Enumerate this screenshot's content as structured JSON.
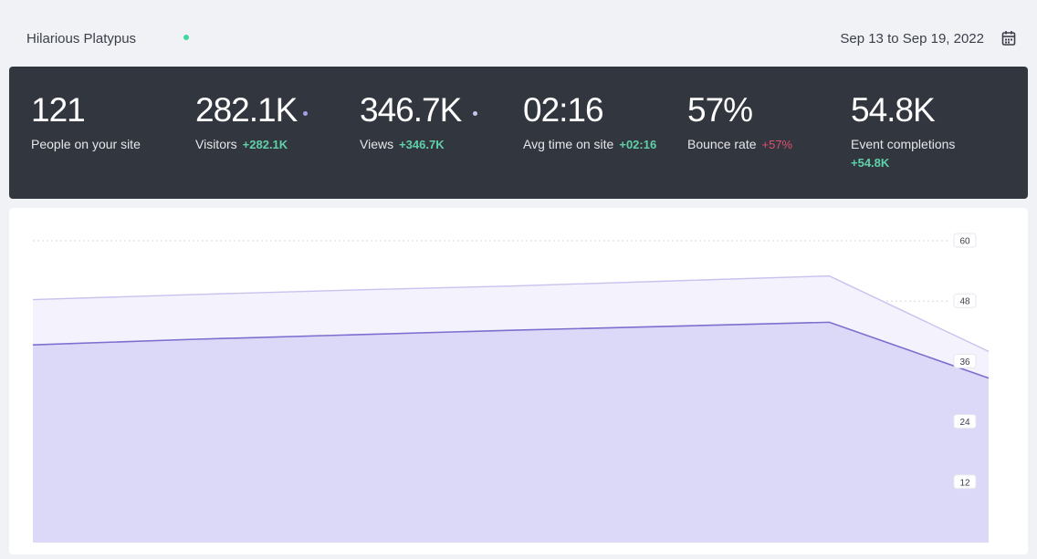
{
  "header": {
    "site_name": "Hilarious Platypus",
    "date_range": "Sep 13 to Sep 19, 2022"
  },
  "icons": {
    "live": "live-status-dot-icon",
    "calendar": "calendar-icon",
    "series_marker": "series-dot-icon"
  },
  "colors": {
    "live": "#3fd6a0",
    "positive": "#5fd0a7",
    "negative": "#e04f6e",
    "panel": "#32363f",
    "visitors": "#7c6fcf",
    "views": "#c9c2ef"
  },
  "stats": [
    {
      "value": "121",
      "label": "People on your site",
      "delta": ""
    },
    {
      "value": "282.1K",
      "label": "Visitors",
      "delta": "+282.1K"
    },
    {
      "value": "346.7K",
      "label": "Views",
      "delta": "+346.7K"
    },
    {
      "value": "02:16",
      "label": "Avg time on site",
      "delta": "+02:16"
    },
    {
      "value": "57%",
      "label": "Bounce rate",
      "delta": "+57%"
    },
    {
      "value": "54.8K",
      "label": "Event completions",
      "delta": "+54.8K"
    }
  ],
  "chart_data": {
    "type": "area",
    "x": [
      0,
      1,
      2,
      3,
      4,
      5,
      6
    ],
    "ylim": [
      0,
      60
    ],
    "y_ticks": [
      12,
      24,
      36,
      48,
      60
    ],
    "grid": true,
    "series": [
      {
        "values": [
          48.3,
          49.3,
          50.2,
          51.0,
          52.0,
          53.0,
          38.0
        ],
        "color": "#c9c2ef"
      },
      {
        "values": [
          39.3,
          40.4,
          41.3,
          42.2,
          43.0,
          43.8,
          32.7
        ],
        "color": "#7c6fcf"
      }
    ]
  }
}
